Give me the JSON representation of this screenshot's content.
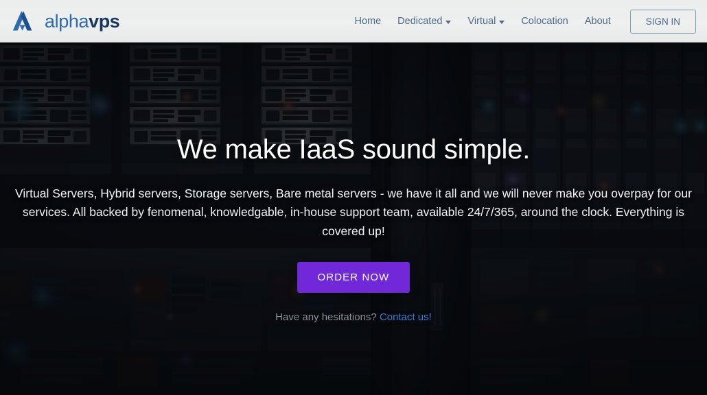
{
  "header": {
    "logo": {
      "icon": "alphavps-logo-mark",
      "text_primary": "alpha",
      "text_secondary": "vps",
      "color_primary": "#2f6aad",
      "color_secondary": "#17375e"
    },
    "nav": [
      {
        "label": "Home",
        "has_dropdown": false,
        "icon": ""
      },
      {
        "label": "Dedicated",
        "has_dropdown": true,
        "icon": "chevron-down-icon"
      },
      {
        "label": "Virtual",
        "has_dropdown": true,
        "icon": "chevron-down-icon"
      },
      {
        "label": "Colocation",
        "has_dropdown": false,
        "icon": ""
      },
      {
        "label": "About",
        "has_dropdown": false,
        "icon": ""
      }
    ],
    "signin_label": "SIGN IN",
    "background": "#eceded",
    "nav_text_color": "#4c6b86"
  },
  "hero": {
    "title": "We make IaaS sound simple.",
    "subtitle": "Virtual Servers, Hybrid servers, Storage servers, Bare metal servers - we have it all and we will never make you overpay for our services. All backed by fenomenal, knowledgable, in-house support team, available 24/7/365, around the clock. Everything is covered up!",
    "cta_label": "ORDER NOW",
    "cta_color": "#7028d8",
    "hesitation_text": "Have any hesitations?",
    "hesitation_link": "Contact us!",
    "hesitation_link_color": "#2f7fd8",
    "background_image": "datacenter-server-racks-photo"
  }
}
